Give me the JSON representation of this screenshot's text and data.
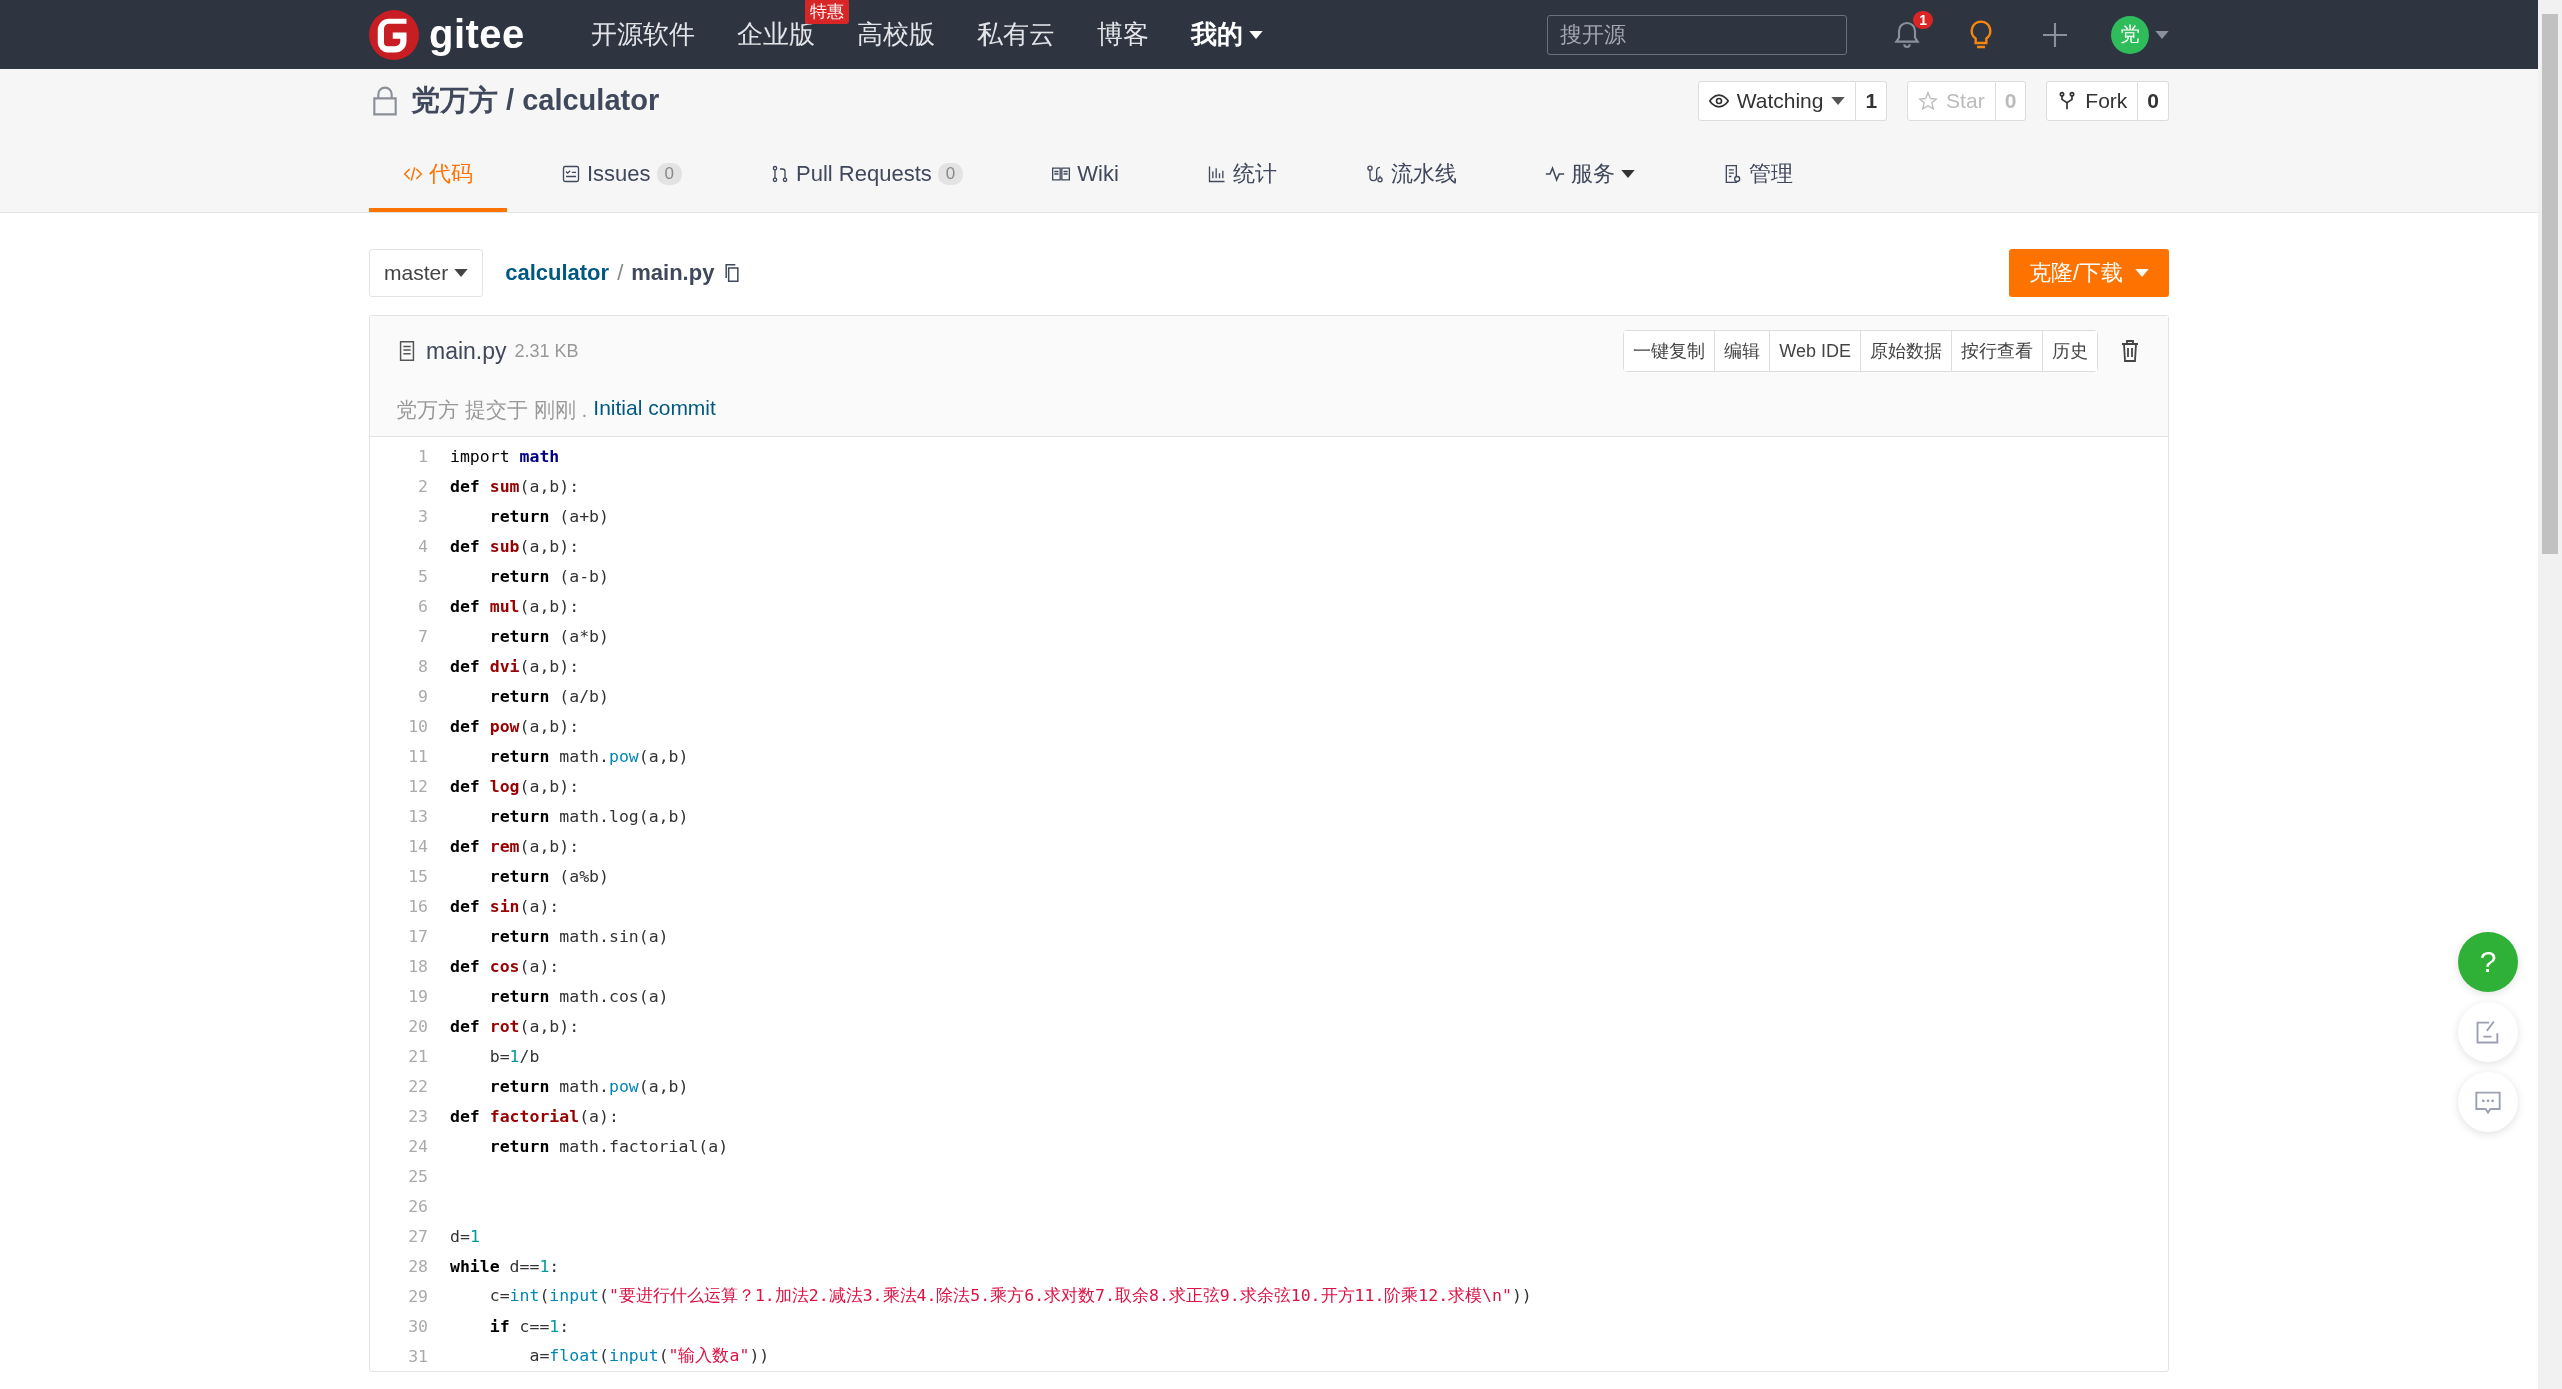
{
  "header": {
    "brand": "gitee",
    "nav": [
      {
        "label": "开源软件",
        "dropdown": false,
        "selected": false
      },
      {
        "label": "企业版",
        "badge": "特惠",
        "dropdown": false,
        "selected": false
      },
      {
        "label": "高校版",
        "dropdown": false,
        "selected": false
      },
      {
        "label": "私有云",
        "dropdown": false,
        "selected": false
      },
      {
        "label": "博客",
        "dropdown": false,
        "selected": false
      },
      {
        "label": "我的",
        "dropdown": true,
        "selected": true
      }
    ],
    "search": {
      "placeholder": "搜开源"
    },
    "notification_count": "1",
    "avatar": "党"
  },
  "repo": {
    "owner": "党万方",
    "separator": "/",
    "name": "calculator",
    "buttons": [
      {
        "label": "Watching",
        "count": "1",
        "dropdown": true,
        "disabled": false
      },
      {
        "label": "Star",
        "count": "0",
        "dropdown": false,
        "disabled": true
      },
      {
        "label": "Fork",
        "count": "0",
        "dropdown": false,
        "disabled": false
      }
    ]
  },
  "tabs": [
    {
      "label": "代码",
      "dropdown": false,
      "selected": true
    },
    {
      "label": "Issues",
      "count": "0",
      "dropdown": false,
      "selected": false
    },
    {
      "label": "Pull Requests",
      "count": "0",
      "dropdown": false,
      "selected": false
    },
    {
      "label": "Wiki",
      "dropdown": false,
      "selected": false
    },
    {
      "label": "统计",
      "dropdown": false,
      "selected": false
    },
    {
      "label": "流水线",
      "dropdown": false,
      "selected": false
    },
    {
      "label": "服务",
      "dropdown": true,
      "selected": false
    },
    {
      "label": "管理",
      "dropdown": false,
      "selected": false
    }
  ],
  "branch": "master",
  "breadcrumb": {
    "repo": "calculator",
    "separator": "/",
    "file": "main.py"
  },
  "clone_button": "克隆/下载",
  "file": {
    "name": "main.py",
    "size": "2.31 KB",
    "actions": [
      "一键复制",
      "编辑",
      "Web IDE",
      "原始数据",
      "按行查看",
      "历史"
    ],
    "commit": {
      "text": "党万方 提交于 刚刚 .",
      "message": "Initial commit"
    },
    "lines": [
      {
        "number": "1",
        "tokens": [
          {
            "kind": "i",
            "text": "import "
          },
          {
            "kind": "m",
            "text": "math"
          }
        ]
      },
      {
        "number": "2",
        "tokens": [
          {
            "kind": "k",
            "text": "def "
          },
          {
            "kind": "f",
            "text": "sum"
          },
          {
            "kind": "p",
            "text": "(a,b):"
          }
        ]
      },
      {
        "number": "3",
        "tokens": [
          {
            "kind": "k",
            "text": "    return"
          },
          {
            "kind": "p",
            "text": " (a+b)"
          }
        ]
      },
      {
        "number": "4",
        "tokens": [
          {
            "kind": "k",
            "text": "def "
          },
          {
            "kind": "f",
            "text": "sub"
          },
          {
            "kind": "p",
            "text": "(a,b):"
          }
        ]
      },
      {
        "number": "5",
        "tokens": [
          {
            "kind": "k",
            "text": "    return"
          },
          {
            "kind": "p",
            "text": " (a-b)"
          }
        ]
      },
      {
        "number": "6",
        "tokens": [
          {
            "kind": "k",
            "text": "def "
          },
          {
            "kind": "f",
            "text": "mul"
          },
          {
            "kind": "p",
            "text": "(a,b):"
          }
        ]
      },
      {
        "number": "7",
        "tokens": [
          {
            "kind": "k",
            "text": "    return"
          },
          {
            "kind": "p",
            "text": " (a*b)"
          }
        ]
      },
      {
        "number": "8",
        "tokens": [
          {
            "kind": "k",
            "text": "def "
          },
          {
            "kind": "f",
            "text": "dvi"
          },
          {
            "kind": "p",
            "text": "(a,b):"
          }
        ]
      },
      {
        "number": "9",
        "tokens": [
          {
            "kind": "k",
            "text": "    return"
          },
          {
            "kind": "p",
            "text": " (a/b)"
          }
        ]
      },
      {
        "number": "10",
        "tokens": [
          {
            "kind": "k",
            "text": "def "
          },
          {
            "kind": "f",
            "text": "pow"
          },
          {
            "kind": "p",
            "text": "(a,b):"
          }
        ]
      },
      {
        "number": "11",
        "tokens": [
          {
            "kind": "k",
            "text": "    return"
          },
          {
            "kind": "p",
            "text": " math."
          },
          {
            "kind": "b",
            "text": "pow"
          },
          {
            "kind": "p",
            "text": "(a,b)"
          }
        ]
      },
      {
        "number": "12",
        "tokens": [
          {
            "kind": "k",
            "text": "def "
          },
          {
            "kind": "f",
            "text": "log"
          },
          {
            "kind": "p",
            "text": "(a,b):"
          }
        ]
      },
      {
        "number": "13",
        "tokens": [
          {
            "kind": "k",
            "text": "    return"
          },
          {
            "kind": "p",
            "text": " math.log(a,b)"
          }
        ]
      },
      {
        "number": "14",
        "tokens": [
          {
            "kind": "k",
            "text": "def "
          },
          {
            "kind": "f",
            "text": "rem"
          },
          {
            "kind": "p",
            "text": "(a,b):"
          }
        ]
      },
      {
        "number": "15",
        "tokens": [
          {
            "kind": "k",
            "text": "    return"
          },
          {
            "kind": "p",
            "text": " (a%b)"
          }
        ]
      },
      {
        "number": "16",
        "tokens": [
          {
            "kind": "k",
            "text": "def "
          },
          {
            "kind": "f",
            "text": "sin"
          },
          {
            "kind": "p",
            "text": "(a):"
          }
        ]
      },
      {
        "number": "17",
        "tokens": [
          {
            "kind": "k",
            "text": "    return"
          },
          {
            "kind": "p",
            "text": " math.sin(a)"
          }
        ]
      },
      {
        "number": "18",
        "tokens": [
          {
            "kind": "k",
            "text": "def "
          },
          {
            "kind": "f",
            "text": "cos"
          },
          {
            "kind": "p",
            "text": "(a):"
          }
        ]
      },
      {
        "number": "19",
        "tokens": [
          {
            "kind": "k",
            "text": "    return"
          },
          {
            "kind": "p",
            "text": " math.cos(a)"
          }
        ]
      },
      {
        "number": "20",
        "tokens": [
          {
            "kind": "k",
            "text": "def "
          },
          {
            "kind": "f",
            "text": "rot"
          },
          {
            "kind": "p",
            "text": "(a,b):"
          }
        ]
      },
      {
        "number": "21",
        "tokens": [
          {
            "kind": "p",
            "text": "    b="
          },
          {
            "kind": "n",
            "text": "1"
          },
          {
            "kind": "p",
            "text": "/b"
          }
        ]
      },
      {
        "number": "22",
        "tokens": [
          {
            "kind": "k",
            "text": "    return"
          },
          {
            "kind": "p",
            "text": " math."
          },
          {
            "kind": "b",
            "text": "pow"
          },
          {
            "kind": "p",
            "text": "(a,b)"
          }
        ]
      },
      {
        "number": "23",
        "tokens": [
          {
            "kind": "k",
            "text": "def "
          },
          {
            "kind": "f",
            "text": "factorial"
          },
          {
            "kind": "p",
            "text": "(a):"
          }
        ]
      },
      {
        "number": "24",
        "tokens": [
          {
            "kind": "k",
            "text": "    return"
          },
          {
            "kind": "p",
            "text": " math.factorial(a)"
          }
        ]
      },
      {
        "number": "25"
      },
      {
        "number": "26"
      },
      {
        "number": "27",
        "tokens": [
          {
            "kind": "p",
            "text": "d="
          },
          {
            "kind": "n",
            "text": "1"
          }
        ]
      },
      {
        "number": "28",
        "tokens": [
          {
            "kind": "k",
            "text": "while"
          },
          {
            "kind": "p",
            "text": " d=="
          },
          {
            "kind": "n",
            "text": "1"
          },
          {
            "kind": "p",
            "text": ":"
          }
        ]
      },
      {
        "number": "29",
        "tokens": [
          {
            "kind": "p",
            "text": "    c="
          },
          {
            "kind": "b",
            "text": "int"
          },
          {
            "kind": "p",
            "text": "("
          },
          {
            "kind": "b",
            "text": "input"
          },
          {
            "kind": "p",
            "text": "("
          },
          {
            "kind": "s",
            "text": "\"要进行什么运算？1.加法2.减法3.乘法4.除法5.乘方6.求对数7.取余8.求正弦9.求余弦10.开方11.阶乘12.求模\\n\""
          },
          {
            "kind": "p",
            "text": "))"
          }
        ]
      },
      {
        "number": "30",
        "tokens": [
          {
            "kind": "k",
            "text": "    if"
          },
          {
            "kind": "p",
            "text": " c=="
          },
          {
            "kind": "n",
            "text": "1"
          },
          {
            "kind": "p",
            "text": ":"
          }
        ]
      },
      {
        "number": "31",
        "tokens": [
          {
            "kind": "p",
            "text": "        a="
          },
          {
            "kind": "b",
            "text": "float"
          },
          {
            "kind": "p",
            "text": "("
          },
          {
            "kind": "b",
            "text": "input"
          },
          {
            "kind": "p",
            "text": "("
          },
          {
            "kind": "s",
            "text": "\"输入数a\""
          },
          {
            "kind": "p",
            "text": "))"
          }
        ]
      }
    ]
  },
  "help_button": "?"
}
